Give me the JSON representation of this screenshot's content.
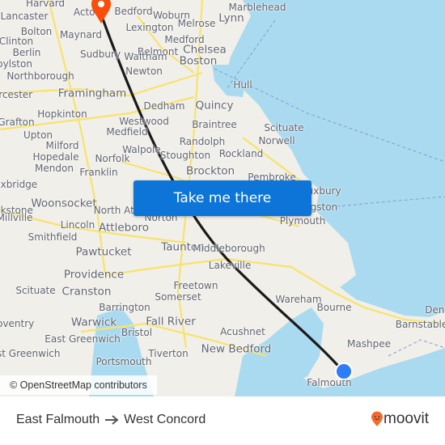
{
  "map": {
    "attribution": "© OpenStreetMap contributors",
    "cta_label": "Take me there",
    "colors": {
      "land": "#f1efe9",
      "water": "#aadaef",
      "road": "#f7e36b",
      "route_line": "#1a1a1a",
      "origin_dot": "#2e7cf6",
      "destination_pin": "#fa4d09",
      "cta": "#0d75d8"
    },
    "origin": {
      "name": "East Falmouth",
      "icon": "origin-dot-icon"
    },
    "destination": {
      "name": "West Concord",
      "icon": "destination-pin-icon"
    },
    "places": [
      {
        "name": "Harvard",
        "size": "m"
      },
      {
        "name": "Bedford",
        "size": "m"
      },
      {
        "name": "Woburn",
        "size": "m"
      },
      {
        "name": "Lynn",
        "size": "l"
      },
      {
        "name": "Marblehead",
        "size": "m"
      },
      {
        "name": "Acton",
        "size": "m"
      },
      {
        "name": "Lancaster",
        "size": "m"
      },
      {
        "name": "Bolton",
        "size": "m"
      },
      {
        "name": "Clinton",
        "size": "m"
      },
      {
        "name": "Maynard",
        "size": "m"
      },
      {
        "name": "Lexington",
        "size": "m"
      },
      {
        "name": "Melrose",
        "size": "m"
      },
      {
        "name": "Medford",
        "size": "m"
      },
      {
        "name": "Berlin",
        "size": "m"
      },
      {
        "name": "Sudbury",
        "size": "m"
      },
      {
        "name": "Belmont",
        "size": "m"
      },
      {
        "name": "Chelsea",
        "size": "l"
      },
      {
        "name": "Waltham",
        "size": "m"
      },
      {
        "name": "Boston",
        "size": "l"
      },
      {
        "name": "Boylston",
        "size": "m"
      },
      {
        "name": "Newton",
        "size": "m"
      },
      {
        "name": "Northborough",
        "size": "m"
      },
      {
        "name": "Hull",
        "size": "m"
      },
      {
        "name": "Framingham",
        "size": "l"
      },
      {
        "name": "Dedham",
        "size": "m"
      },
      {
        "name": "Quincy",
        "size": "l"
      },
      {
        "name": "Worcester",
        "size": "m"
      },
      {
        "name": "Hopkinton",
        "size": "m"
      },
      {
        "name": "Grafton",
        "size": "m"
      },
      {
        "name": "Westwood",
        "size": "m"
      },
      {
        "name": "Braintree",
        "size": "m"
      },
      {
        "name": "Scituate",
        "size": "m"
      },
      {
        "name": "Medfield",
        "size": "m"
      },
      {
        "name": "Upton",
        "size": "m"
      },
      {
        "name": "Randolph",
        "size": "m"
      },
      {
        "name": "Norwell",
        "size": "m"
      },
      {
        "name": "Milford",
        "size": "m"
      },
      {
        "name": "Walpole",
        "size": "m"
      },
      {
        "name": "Norfolk",
        "size": "m"
      },
      {
        "name": "Hopedale",
        "size": "m"
      },
      {
        "name": "Stoughton",
        "size": "m"
      },
      {
        "name": "Rockland",
        "size": "m"
      },
      {
        "name": "Mendon",
        "size": "m"
      },
      {
        "name": "Franklin",
        "size": "m"
      },
      {
        "name": "Brockton",
        "size": "l"
      },
      {
        "name": "Pembroke",
        "size": "m"
      },
      {
        "name": "Uxbridge",
        "size": "m"
      },
      {
        "name": "Duxbury",
        "size": "m"
      },
      {
        "name": "Woonsocket",
        "size": "l"
      },
      {
        "name": "North Attleboro",
        "size": "m"
      },
      {
        "name": "Norton",
        "size": "m"
      },
      {
        "name": "Kingston",
        "size": "m"
      },
      {
        "name": "Blackstone",
        "size": "m"
      },
      {
        "name": "Millville",
        "size": "m"
      },
      {
        "name": "Lincoln",
        "size": "m"
      },
      {
        "name": "Attleboro",
        "size": "l"
      },
      {
        "name": "Plymouth",
        "size": "m"
      },
      {
        "name": "Smithfield",
        "size": "m"
      },
      {
        "name": "Taunton",
        "size": "l"
      },
      {
        "name": "Middleborough",
        "size": "m"
      },
      {
        "name": "Pawtucket",
        "size": "l"
      },
      {
        "name": "Lakeville",
        "size": "m"
      },
      {
        "name": "Providence",
        "size": "l"
      },
      {
        "name": "Freetown",
        "size": "m"
      },
      {
        "name": "Cranston",
        "size": "l"
      },
      {
        "name": "Scituate",
        "size": "m"
      },
      {
        "name": "Somerset",
        "size": "m"
      },
      {
        "name": "Wareham",
        "size": "m"
      },
      {
        "name": "Bourne",
        "size": "m"
      },
      {
        "name": "Barrington",
        "size": "m"
      },
      {
        "name": "Coventry",
        "size": "m"
      },
      {
        "name": "Warwick",
        "size": "l"
      },
      {
        "name": "Fall River",
        "size": "l"
      },
      {
        "name": "Bristol",
        "size": "m"
      },
      {
        "name": "Barnstable",
        "size": "m"
      },
      {
        "name": "East Greenwich",
        "size": "m"
      },
      {
        "name": "Acushnet",
        "size": "m"
      },
      {
        "name": "Mashpee",
        "size": "m"
      },
      {
        "name": "Tiverton",
        "size": "m"
      },
      {
        "name": "West Greenwich",
        "size": "m"
      },
      {
        "name": "New Bedford",
        "size": "l"
      },
      {
        "name": "Portsmouth",
        "size": "m"
      },
      {
        "name": "Falmouth",
        "size": "m"
      },
      {
        "name": "Dennis",
        "size": "m"
      }
    ]
  },
  "footer": {
    "origin": "East Falmouth",
    "destination": "West Concord",
    "arrow_icon": "arrow-right-icon",
    "brand": "moovit"
  }
}
